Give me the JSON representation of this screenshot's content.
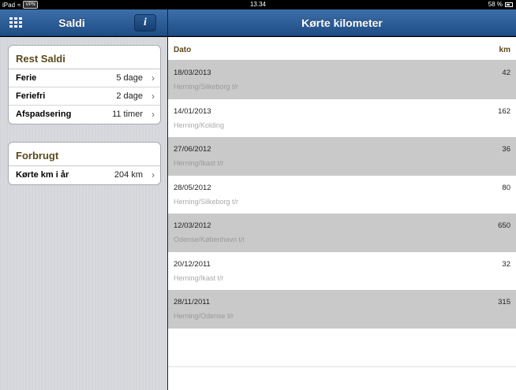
{
  "status_bar": {
    "device": "iPad",
    "vpn": "VPN",
    "time": "13.34",
    "battery": "58 %"
  },
  "sidebar": {
    "title": "Saldi",
    "info_label": "i",
    "groups": [
      {
        "title": "Rest Saldi",
        "rows": [
          {
            "label": "Ferie",
            "value": "5 dage"
          },
          {
            "label": "Feriefri",
            "value": "2 dage"
          },
          {
            "label": "Afspadsering",
            "value": "11 timer"
          }
        ]
      },
      {
        "title": "Forbrugt",
        "rows": [
          {
            "label": "Kørte km i år",
            "value": "204 km"
          }
        ]
      }
    ]
  },
  "main": {
    "title": "Kørte kilometer",
    "columns": {
      "date": "Dato",
      "km": "km"
    },
    "trips": [
      {
        "date": "18/03/2013",
        "route": "Herning/Silkeborg t/r",
        "km": "42"
      },
      {
        "date": "14/01/2013",
        "route": "Herning/Kolding",
        "km": "162"
      },
      {
        "date": "27/06/2012",
        "route": "Herning/Ikast t/r",
        "km": "36"
      },
      {
        "date": "28/05/2012",
        "route": "Herning/Silkeborg t/r",
        "km": "80"
      },
      {
        "date": "12/03/2012",
        "route": "Odense/København t/r",
        "km": "650"
      },
      {
        "date": "20/12/2011",
        "route": "Herning/Ikast t/r",
        "km": "32"
      },
      {
        "date": "28/11/2011",
        "route": "Herning/Odense t/r",
        "km": "315"
      }
    ]
  },
  "colors": {
    "nav_bar": "#2a5b95",
    "section_title": "#5a4a1a",
    "row_shade": "#c9c9c9"
  }
}
